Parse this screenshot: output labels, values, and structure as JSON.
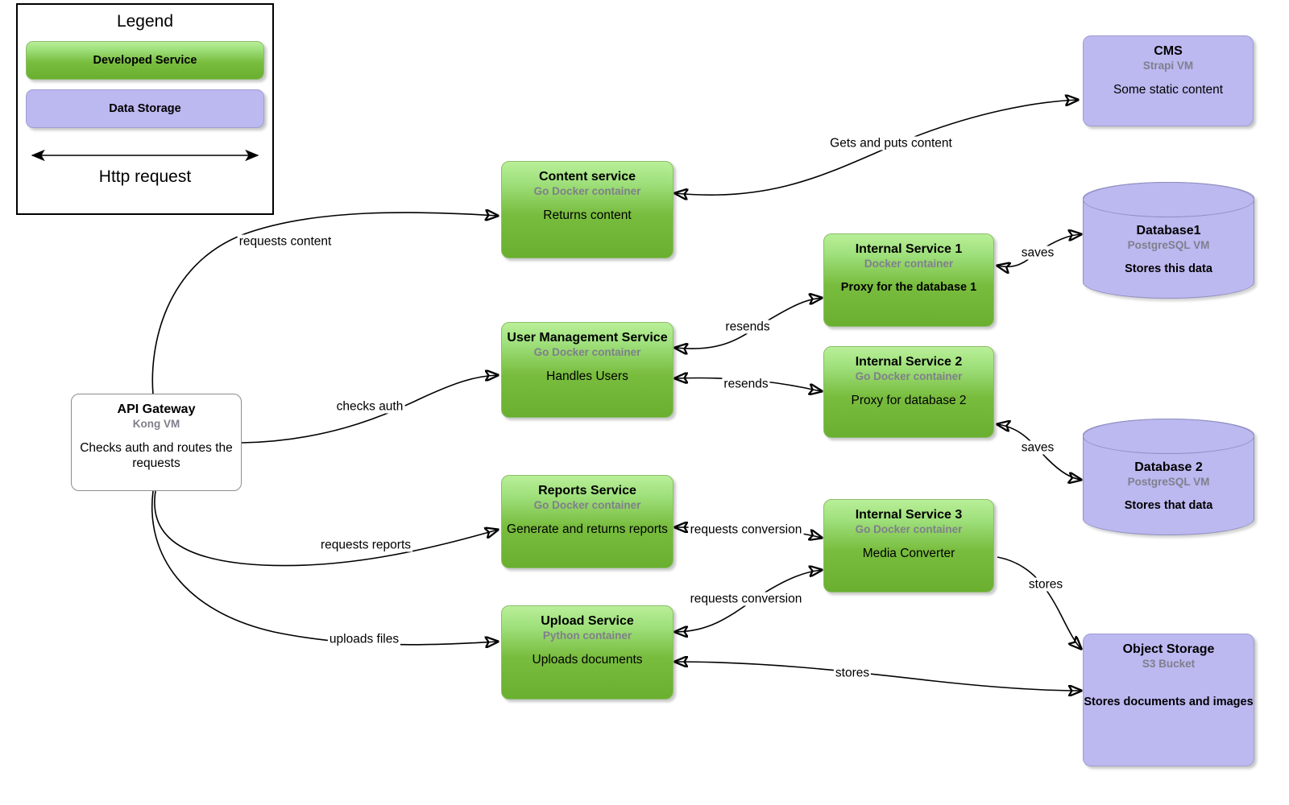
{
  "legend": {
    "title": "Legend",
    "items": [
      {
        "label": "Developed Service",
        "kind": "green"
      },
      {
        "label": "Data Storage",
        "kind": "purple"
      }
    ],
    "edge_label": "Http request"
  },
  "nodes": {
    "api_gateway": {
      "title": "API Gateway",
      "subtitle": "Kong VM",
      "body": "Checks auth and routes the requests"
    },
    "content": {
      "title": "Content service",
      "subtitle": "Go Docker container",
      "body": "Returns content"
    },
    "user_mgmt": {
      "title": "User Management Service",
      "subtitle": "Go Docker container",
      "body": "Handles Users"
    },
    "reports": {
      "title": "Reports Service",
      "subtitle": "Go Docker container",
      "body": "Generate and returns reports"
    },
    "upload": {
      "title": "Upload Service",
      "subtitle": "Python container",
      "body": "Uploads documents"
    },
    "internal1": {
      "title": "Internal Service 1",
      "subtitle": "Docker container",
      "body": "Proxy for the database 1"
    },
    "internal2": {
      "title": "Internal Service 2",
      "subtitle": "Go Docker container",
      "body": "Proxy for database 2"
    },
    "internal3": {
      "title": "Internal Service 3",
      "subtitle": "Go Docker container",
      "body": "Media Converter"
    },
    "cms": {
      "title": "CMS",
      "subtitle": "Strapi VM",
      "body": "Some static content"
    },
    "database1": {
      "title": "Database1",
      "subtitle": "PostgreSQL VM",
      "body": "Stores this data"
    },
    "database2": {
      "title": "Database 2",
      "subtitle": "PostgreSQL VM",
      "body": "Stores that data"
    },
    "object_storage": {
      "title": "Object Storage",
      "subtitle": "S3 Bucket",
      "body": "Stores documents and images"
    }
  },
  "edges": [
    {
      "id": "requests-content",
      "label": "requests content"
    },
    {
      "id": "checks-auth",
      "label": "checks auth"
    },
    {
      "id": "requests-reports",
      "label": "requests reports"
    },
    {
      "id": "uploads-files",
      "label": "uploads files"
    },
    {
      "id": "gets-and-puts-content",
      "label": "Gets and puts content"
    },
    {
      "id": "resends-1",
      "label": "resends"
    },
    {
      "id": "resends-2",
      "label": "resends"
    },
    {
      "id": "saves-1",
      "label": "saves"
    },
    {
      "id": "saves-2",
      "label": "saves"
    },
    {
      "id": "requests-conversion-1",
      "label": "requests conversion"
    },
    {
      "id": "requests-conversion-2",
      "label": "requests conversion"
    },
    {
      "id": "stores-1",
      "label": "stores"
    },
    {
      "id": "stores-2",
      "label": "stores"
    }
  ],
  "colors": {
    "service_top": "#b9ef98",
    "service_bottom": "#6aaf2f",
    "storage": "#bcb8f0",
    "edge": "#000000",
    "subtitle": "#7f7f8c"
  }
}
